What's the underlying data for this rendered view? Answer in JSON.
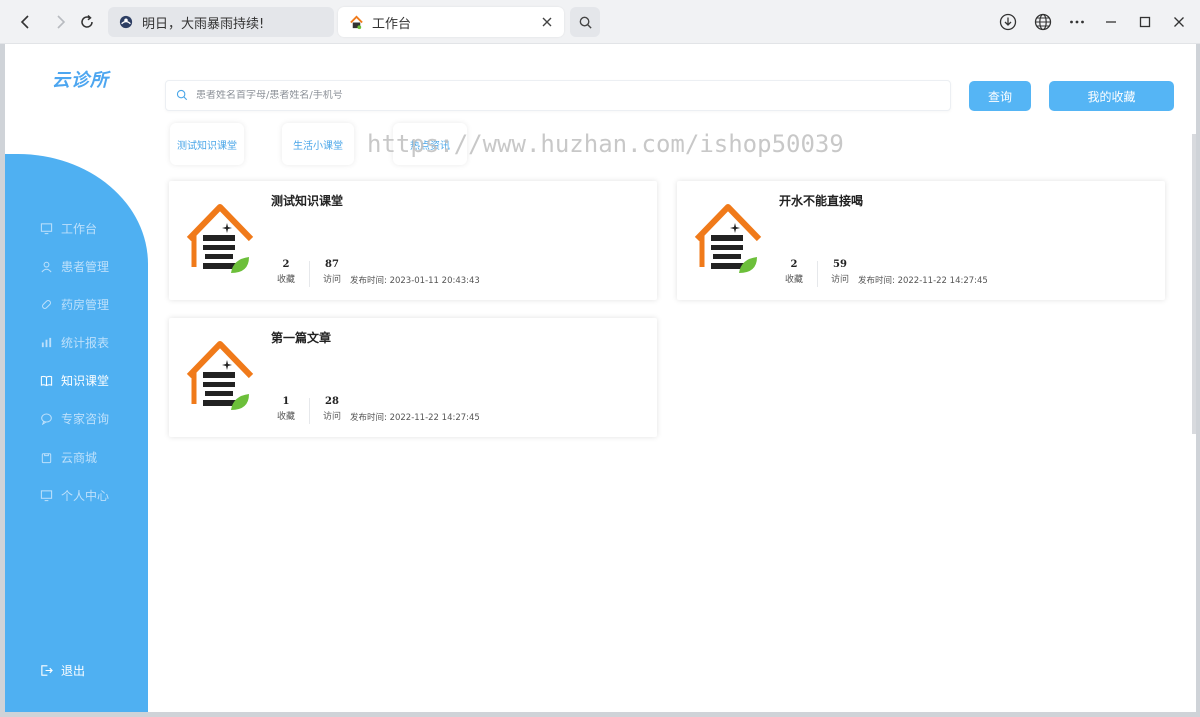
{
  "browser": {
    "tabs": [
      {
        "title": "明日，大雨暴雨持续!"
      },
      {
        "title": "工作台"
      }
    ]
  },
  "app": {
    "logo": "云诊所",
    "sidebar": {
      "items": [
        {
          "label": "工作台",
          "icon": "monitor-icon",
          "active": false
        },
        {
          "label": "患者管理",
          "icon": "user-icon",
          "active": false
        },
        {
          "label": "药房管理",
          "icon": "pill-icon",
          "active": false
        },
        {
          "label": "统计报表",
          "icon": "bar-chart-icon",
          "active": false
        },
        {
          "label": "知识课堂",
          "icon": "book-icon",
          "active": true
        },
        {
          "label": "专家咨询",
          "icon": "chat-icon",
          "active": false
        },
        {
          "label": "云商城",
          "icon": "shopping-bag-icon",
          "active": false
        },
        {
          "label": "个人中心",
          "icon": "monitor-icon",
          "active": false
        }
      ],
      "logout": "退出"
    },
    "search": {
      "placeholder": "患者姓名首字母/患者姓名/手机号",
      "value": ""
    },
    "query_button": "查询",
    "favorites_button": "我的收藏",
    "categories": [
      "测试知识课堂",
      "生活小课堂",
      "热点资讯"
    ],
    "watermark": "https://www.huzhan.com/ishop50039",
    "articles": [
      {
        "title": "测试知识课堂",
        "favorites": "2",
        "favorites_label": "收藏",
        "visits": "87",
        "visits_label": "访问",
        "published": "发布时间: 2023-01-11 20:43:43"
      },
      {
        "title": "开水不能直接喝",
        "favorites": "2",
        "favorites_label": "收藏",
        "visits": "59",
        "visits_label": "访问",
        "published": "发布时间: 2022-11-22 14:27:45"
      },
      {
        "title": "第一篇文章",
        "favorites": "1",
        "favorites_label": "收藏",
        "visits": "28",
        "visits_label": "访问",
        "published": "发布时间: 2022-11-22 14:27:45"
      }
    ],
    "colors": {
      "accent": "#4fb0f2",
      "button": "#55b5f5",
      "logo_roof": "#f07a1a",
      "logo_leaf": "#6cbf3a"
    }
  }
}
